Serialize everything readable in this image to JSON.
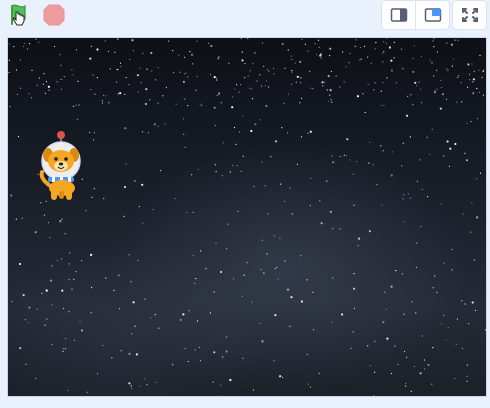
{
  "controls": {
    "green_flag_icon": "green-flag-icon",
    "stop_icon": "stop-icon",
    "small_stage_icon": "small-stage-icon",
    "normal_stage_icon": "normal-stage-icon",
    "fullscreen_icon": "fullscreen-icon"
  },
  "colors": {
    "flag": "#4cbf56",
    "stop": "#ec9c9c",
    "accent": "#4c97ff",
    "page_bg": "#e9f1fc"
  },
  "stage": {
    "backdrop": "stars",
    "sprite": "dog-astronaut"
  }
}
